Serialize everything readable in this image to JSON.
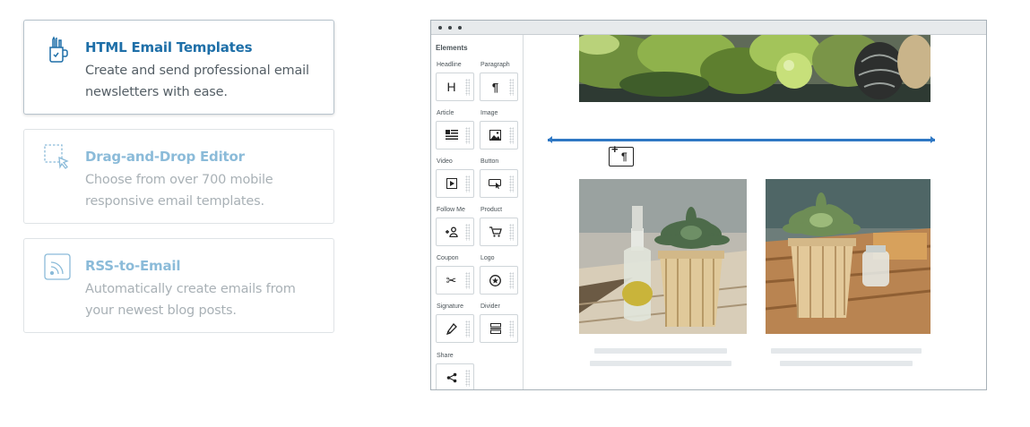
{
  "features": [
    {
      "title": "HTML Email Templates",
      "description": "Create and send professional email newsletters with ease.",
      "icon": "pencil-cup-icon",
      "active": true
    },
    {
      "title": "Drag-and-Drop Editor",
      "description": "Choose from over 700 mobile responsive email templates.",
      "icon": "drag-select-cursor-icon",
      "active": false
    },
    {
      "title": "RSS-to-Email",
      "description": "Automatically create emails from your newest blog posts.",
      "icon": "rss-icon",
      "active": false
    }
  ],
  "editor": {
    "panel_heading": "Elements",
    "elements": [
      {
        "label": "Headline",
        "glyph": "H",
        "icon": "headline-icon"
      },
      {
        "label": "Paragraph",
        "glyph": "¶",
        "icon": "paragraph-icon"
      },
      {
        "label": "Article",
        "glyph": "",
        "icon": "article-icon"
      },
      {
        "label": "Image",
        "glyph": "",
        "icon": "image-icon"
      },
      {
        "label": "Video",
        "glyph": "",
        "icon": "video-icon"
      },
      {
        "label": "Button",
        "glyph": "",
        "icon": "button-cursor-icon"
      },
      {
        "label": "Follow Me",
        "glyph": "",
        "icon": "follow-me-icon"
      },
      {
        "label": "Product",
        "glyph": "",
        "icon": "cart-icon"
      },
      {
        "label": "Coupon",
        "glyph": "✂",
        "icon": "scissors-icon"
      },
      {
        "label": "Logo",
        "glyph": "",
        "icon": "logo-icon"
      },
      {
        "label": "Signature",
        "glyph": "",
        "icon": "pen-icon"
      },
      {
        "label": "Divider",
        "glyph": "",
        "icon": "divider-icon"
      },
      {
        "label": "Share",
        "glyph": "",
        "icon": "share-icon"
      }
    ],
    "drag_glyph": "¶",
    "colors": {
      "insertion_line": "#2f78c4",
      "accent_title": "#1e6fa8"
    }
  }
}
